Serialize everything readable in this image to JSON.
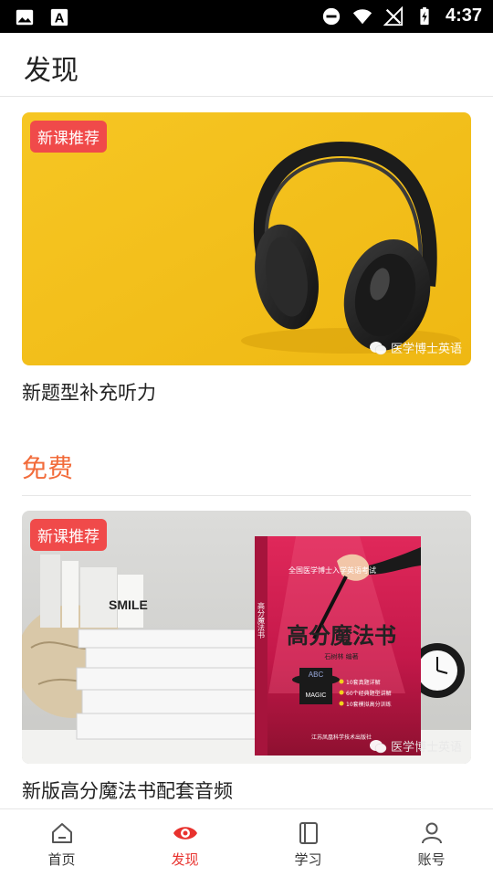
{
  "status_bar": {
    "time": "4:37",
    "icons": [
      "image-icon",
      "text-a-icon",
      "do-not-disturb-icon",
      "wifi-icon",
      "signal-off-icon",
      "battery-charging-icon"
    ]
  },
  "header": {
    "title": "发现"
  },
  "cards": [
    {
      "badge": "新课推荐",
      "title": "新题型补充听力",
      "watermark": "医学博士英语",
      "image_subject": "headphones-on-yellow"
    },
    {
      "badge": "新课推荐",
      "title": "新版高分魔法书配套音频",
      "watermark": "医学博士英语",
      "image_subject": "book-on-shelf",
      "book_text": {
        "top": "全国医学博士入学英语考试",
        "title": "高分魔法书",
        "author": "石树林 编著",
        "bullets": [
          "10套真题详解",
          "60个经典题型讲解",
          "10套模拟高分训练"
        ],
        "publisher": "江苏凤凰科学技术出版社",
        "side": "高分魔法书",
        "hat_label": "ABC",
        "hat_text": "MAGIC",
        "shelf_book_title": "SMILE"
      }
    }
  ],
  "section": {
    "title": "免费"
  },
  "bottom_nav": {
    "active": "discover",
    "items": [
      {
        "key": "home",
        "label": "首页",
        "icon": "home-icon"
      },
      {
        "key": "discover",
        "label": "发现",
        "icon": "eye-icon"
      },
      {
        "key": "study",
        "label": "学习",
        "icon": "book-icon"
      },
      {
        "key": "account",
        "label": "账号",
        "icon": "person-icon"
      }
    ]
  },
  "colors": {
    "accent_red": "#e8322e",
    "badge_red": "#f04a4a",
    "section_orange": "#f26b3a",
    "banner_yellow": "#f4c21f"
  }
}
